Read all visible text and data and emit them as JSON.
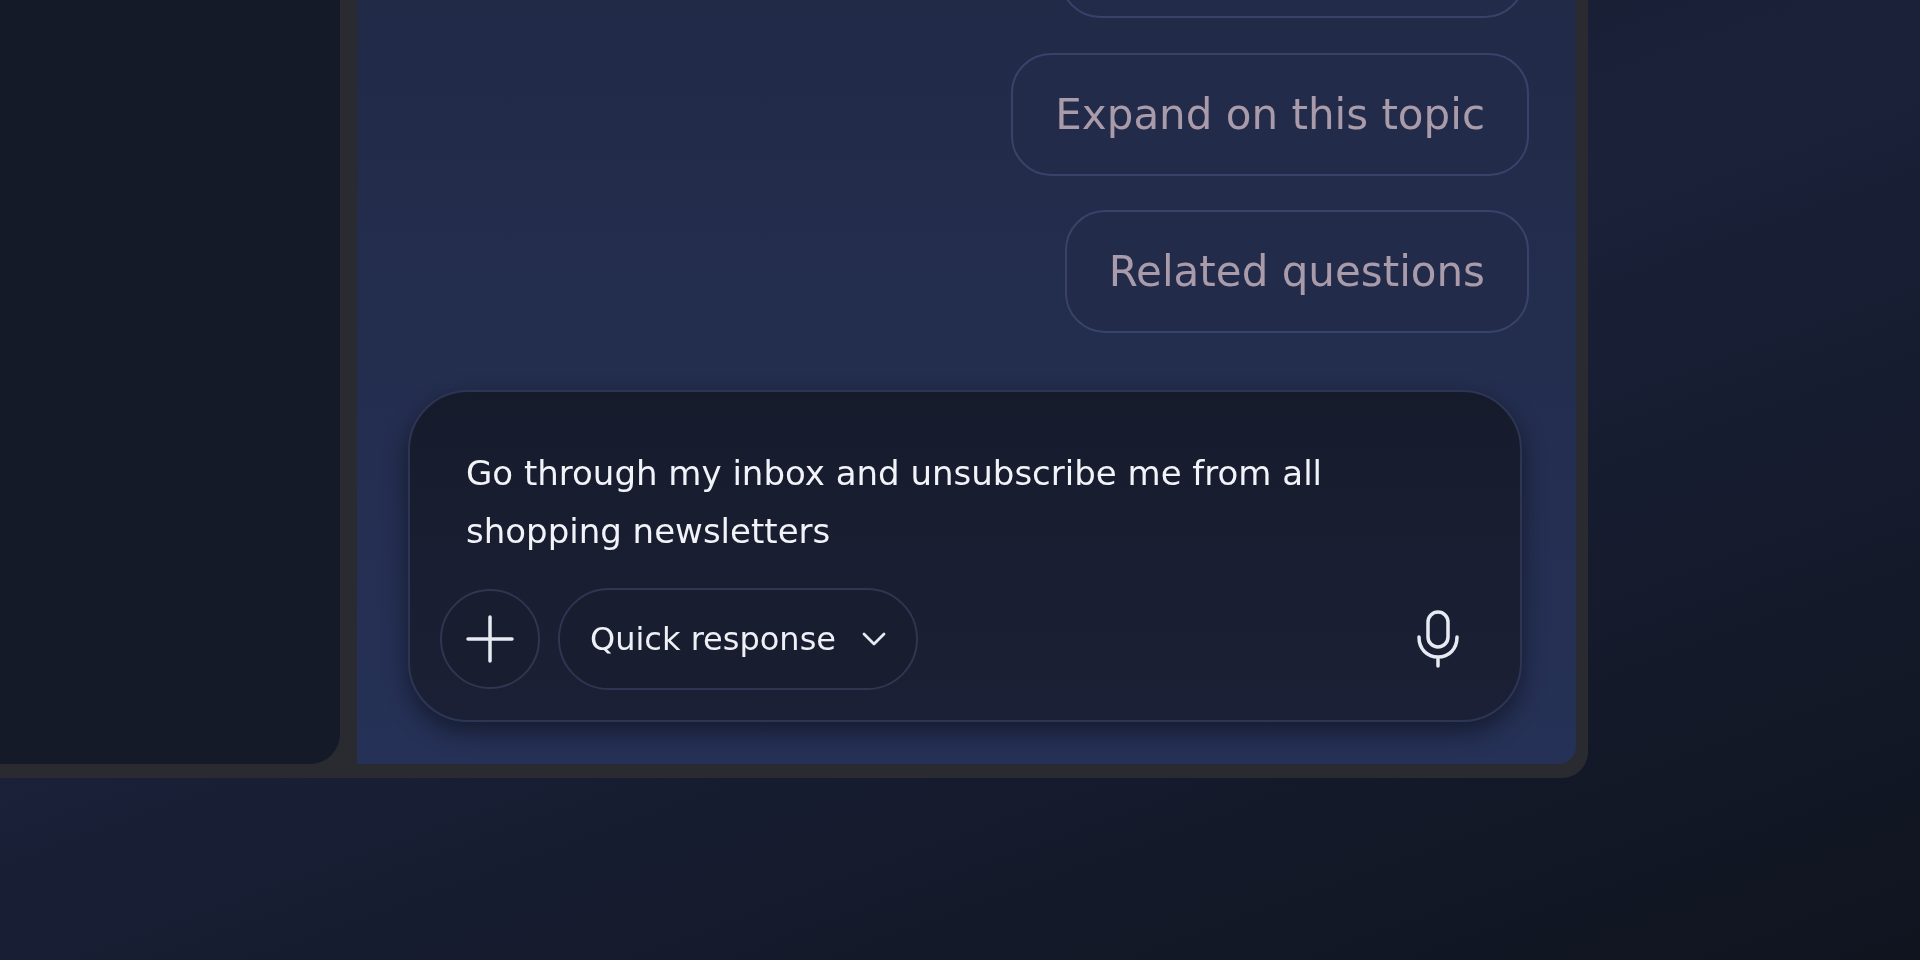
{
  "suggestions": [
    {
      "label": "Expand on this topic"
    },
    {
      "label": "Related questions"
    }
  ],
  "composer": {
    "value": "Go through my inbox and unsubscribe me from all shopping newsletters",
    "mode_button": {
      "label": "Quick response"
    }
  }
}
